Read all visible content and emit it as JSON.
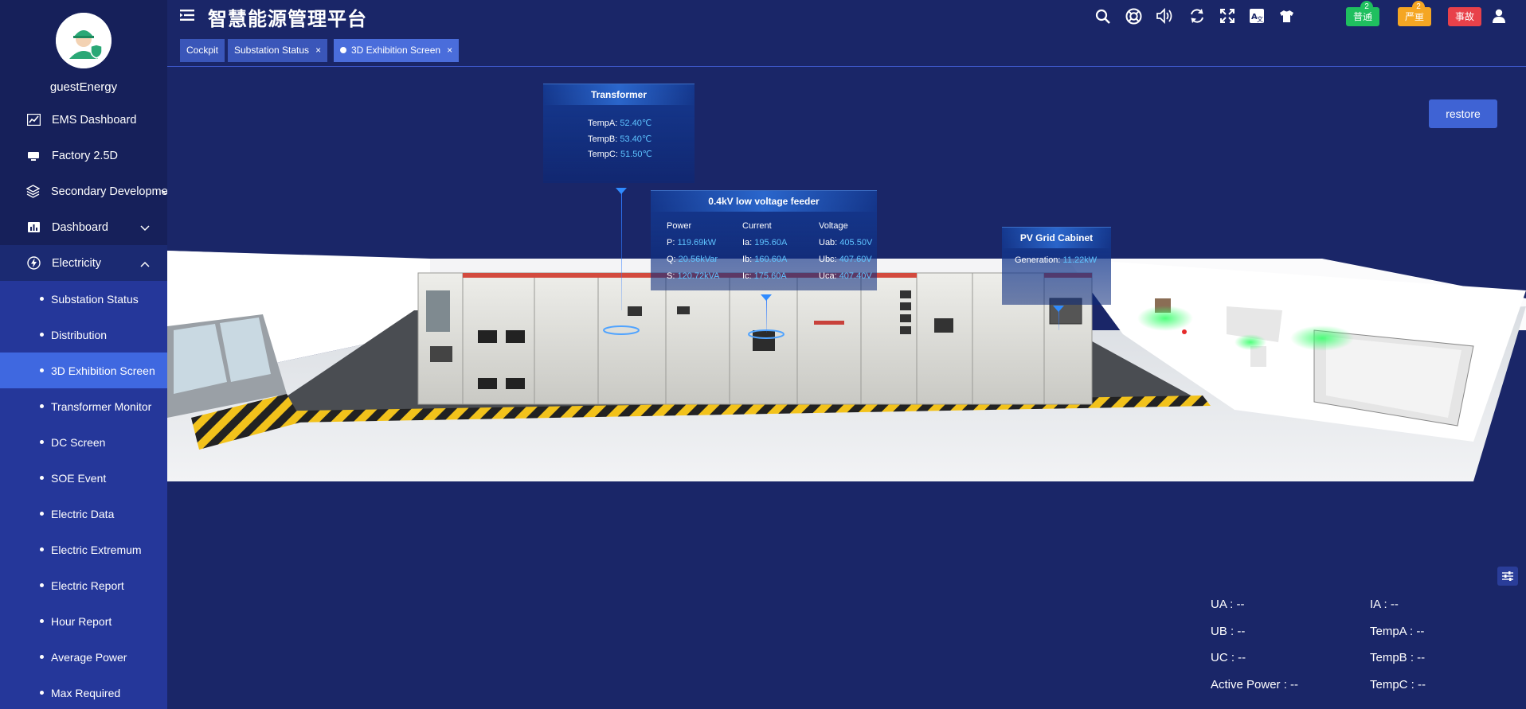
{
  "app": {
    "title": "智慧能源管理平台"
  },
  "user": {
    "name": "guestEnergy"
  },
  "sidebar": {
    "items": [
      {
        "label": "EMS Dashboard",
        "icon": "chart-line-icon"
      },
      {
        "label": "Factory 2.5D",
        "icon": "monitor-icon"
      },
      {
        "label": "Secondary Development",
        "icon": "layers-icon"
      },
      {
        "label": "Dashboard",
        "icon": "bar-chart-icon"
      },
      {
        "label": "Electricity",
        "icon": "electricity-icon"
      }
    ],
    "submenu": [
      "Substation Status",
      "Distribution",
      "3D Exhibition Screen",
      "Transformer Monitor",
      "DC Screen",
      "SOE Event",
      "Electric Data",
      "Electric Extremum",
      "Electric Report",
      "Hour Report",
      "Average Power",
      "Max Required"
    ],
    "active_sub": "3D Exhibition Screen"
  },
  "header": {
    "alarms": [
      {
        "label": "普通",
        "count": "2",
        "color": "#1fbf5f"
      },
      {
        "label": "严重",
        "count": "2",
        "color": "#f5a623"
      },
      {
        "label": "事故",
        "count": "",
        "color": "#e8414a"
      }
    ]
  },
  "tabs": [
    {
      "label": "Cockpit",
      "closable": false
    },
    {
      "label": "Substation Status",
      "closable": true
    },
    {
      "label": "3D Exhibition Screen",
      "closable": true,
      "active": true
    }
  ],
  "tab_close_glyph": "×",
  "restore_label": "restore",
  "transformer": {
    "title": "Transformer",
    "rows": [
      {
        "label": "TempA: ",
        "value": "52.40℃"
      },
      {
        "label": "TempB: ",
        "value": "53.40℃"
      },
      {
        "label": "TempC: ",
        "value": "51.50℃"
      }
    ]
  },
  "feeder": {
    "title": "0.4kV low voltage feeder",
    "headers": [
      "Power",
      "Current",
      "Voltage"
    ],
    "rows": [
      [
        {
          "label": "P: ",
          "value": "119.69kW"
        },
        {
          "label": "Ia: ",
          "value": "195.60A"
        },
        {
          "label": "Uab: ",
          "value": "405.50V"
        }
      ],
      [
        {
          "label": "Q: ",
          "value": "20.56kVar"
        },
        {
          "label": "Ib: ",
          "value": "160.60A"
        },
        {
          "label": "Ubc: ",
          "value": "407.60V"
        }
      ],
      [
        {
          "label": "S: ",
          "value": "120.72kVA"
        },
        {
          "label": "Ic: ",
          "value": "175.60A"
        },
        {
          "label": "Uca: ",
          "value": "407.40V"
        }
      ]
    ]
  },
  "pv": {
    "title": "PV Grid Cabinet",
    "label": "Generation: ",
    "value": "11.22kW"
  },
  "readouts": {
    "left": [
      "UA : --",
      "UB : --",
      "UC : --",
      "Active Power : --"
    ],
    "right": [
      "IA : --",
      "TempA : --",
      "TempB : --",
      "TempC : --"
    ]
  }
}
